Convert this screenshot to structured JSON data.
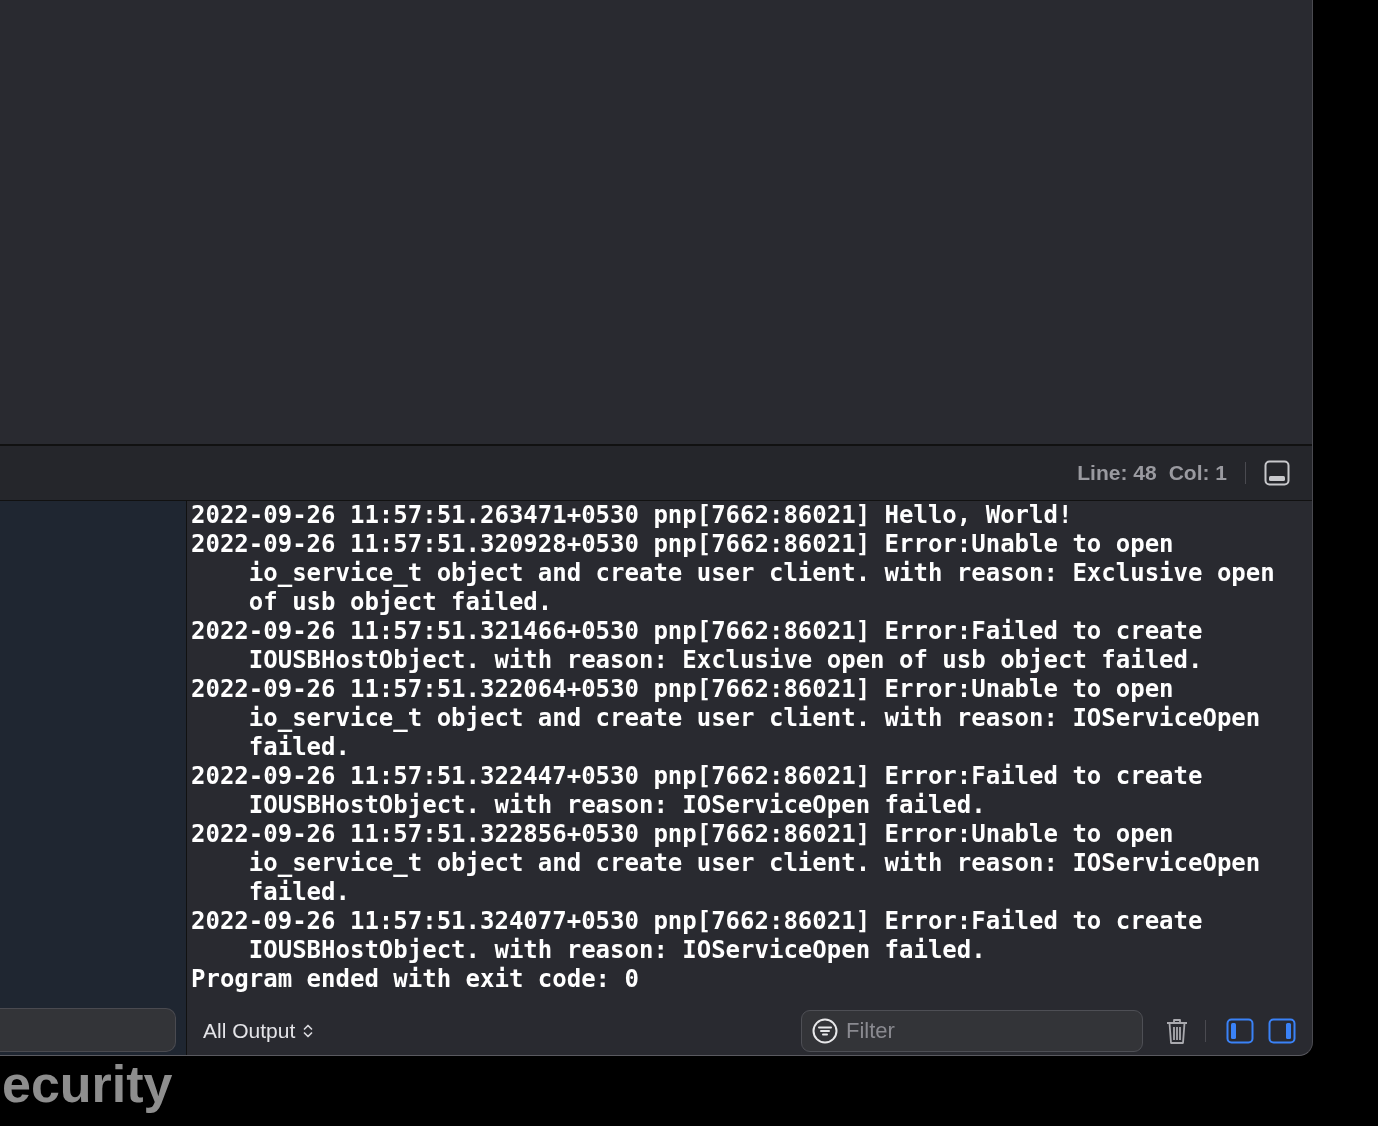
{
  "status_bar": {
    "line": "Line: 48",
    "col": "Col: 1"
  },
  "console": {
    "log": [
      "2022-09-26 11:57:51.263471+0530 pnp[7662:86021] Hello, World!",
      "2022-09-26 11:57:51.320928+0530 pnp[7662:86021] Error:Unable to open io_service_t object and create user client. with reason: Exclusive open of usb object failed.",
      "2022-09-26 11:57:51.321466+0530 pnp[7662:86021] Error:Failed to create IOUSBHostObject. with reason: Exclusive open of usb object failed.",
      "2022-09-26 11:57:51.322064+0530 pnp[7662:86021] Error:Unable to open io_service_t object and create user client. with reason: IOServiceOpen failed.",
      "2022-09-26 11:57:51.322447+0530 pnp[7662:86021] Error:Failed to create IOUSBHostObject. with reason: IOServiceOpen failed.",
      "2022-09-26 11:57:51.322856+0530 pnp[7662:86021] Error:Unable to open io_service_t object and create user client. with reason: IOServiceOpen failed.",
      "2022-09-26 11:57:51.324077+0530 pnp[7662:86021] Error:Failed to create IOUSBHostObject. with reason: IOServiceOpen failed.",
      "Program ended with exit code: 0"
    ]
  },
  "output_menu": {
    "label": "All Output"
  },
  "filter": {
    "placeholder": "Filter"
  },
  "panel_toggles": [
    {
      "kind": "left",
      "on": true
    },
    {
      "kind": "right",
      "on": true
    }
  ],
  "background_text": "ecurity"
}
